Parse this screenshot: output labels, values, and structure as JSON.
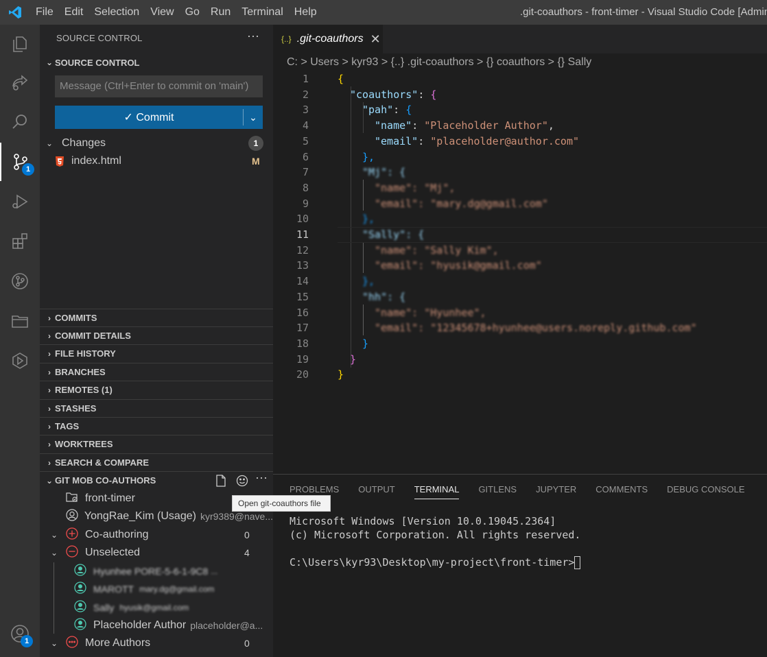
{
  "titlebar": {
    "menu": [
      "File",
      "Edit",
      "Selection",
      "View",
      "Go",
      "Run",
      "Terminal",
      "Help"
    ],
    "window_title": ".git-coauthors - front-timer - Visual Studio Code [Adminis"
  },
  "activity": {
    "scm_badge": "1",
    "accounts_badge": "1"
  },
  "sidebar": {
    "title": "SOURCE CONTROL",
    "more": "···",
    "scm_section": "SOURCE CONTROL",
    "message_placeholder": "Message (Ctrl+Enter to commit on 'main')",
    "commit_label": "✓ Commit",
    "changes_label": "Changes",
    "changes_count": "1",
    "file_name": "index.html",
    "file_status": "M",
    "sections": [
      "COMMITS",
      "COMMIT DETAILS",
      "FILE HISTORY",
      "BRANCHES",
      "REMOTES (1)",
      "STASHES",
      "TAGS",
      "WORKTREES",
      "SEARCH & COMPARE"
    ],
    "gitmob": {
      "title": "GIT MOB CO-AUTHORS",
      "repo": "front-timer",
      "user_name": "YongRae_Kim (Usage)",
      "user_email": "kyr9389@nave...",
      "coauthoring_label": "Co-authoring",
      "coauthoring_count": "0",
      "unselected_label": "Unselected",
      "unselected_count": "4",
      "authors": [
        {
          "name": "Hyunhee PORE-5-6-1-9C8",
          "email": "..."
        },
        {
          "name": "MAROTT",
          "email": "mary.dg@gmail.com"
        },
        {
          "name": "Sally",
          "email": "hyusik@gmail.com"
        },
        {
          "name": "Placeholder Author",
          "email": "placeholder@a..."
        }
      ],
      "more_authors_label": "More Authors",
      "more_authors_count": "0"
    }
  },
  "tooltip": "Open git-coauthors file",
  "editor": {
    "tab_label": ".git-coauthors",
    "breadcrumb": "C: > Users > kyr93 > {..} .git-coauthors > {} coauthors > {} Sally",
    "current_line": 11,
    "lines": [
      "1",
      "2",
      "3",
      "4",
      "5",
      "6",
      "7",
      "8",
      "9",
      "10",
      "11",
      "12",
      "13",
      "14",
      "15",
      "16",
      "17",
      "18",
      "19",
      "20"
    ],
    "code": {
      "l1": "{",
      "l2_key": "\"coauthors\"",
      "l3_key": "\"pah\"",
      "l4_key": "\"name\"",
      "l4_val": "\"Placeholder Author\"",
      "l5_key": "\"email\"",
      "l5_val": "\"placeholder@author.com\"",
      "l6": "},",
      "l7": "\"Mj\": {",
      "l8": "\"name\": \"Mj\",",
      "l9": "\"email\": \"mary.dg@gmail.com\"",
      "l10": "},",
      "l11": "\"Sally\": {",
      "l12": "\"name\": \"Sally Kim\",",
      "l13": "\"email\": \"hyusik@gmail.com\"",
      "l14": "},",
      "l15": "\"hh\": {",
      "l16": "\"name\": \"Hyunhee\",",
      "l17": "\"email\": \"12345678+hyunhee@users.noreply.github.com\"",
      "l18": "}",
      "l19": "}",
      "l20": "}"
    }
  },
  "panel": {
    "tabs": [
      "PROBLEMS",
      "OUTPUT",
      "TERMINAL",
      "GITLENS",
      "JUPYTER",
      "COMMENTS",
      "DEBUG CONSOLE"
    ],
    "active_tab": "TERMINAL",
    "terminal_lines": [
      "Microsoft Windows [Version 10.0.19045.2364]",
      "(c) Microsoft Corporation. All rights reserved.",
      "",
      "C:\\Users\\kyr93\\Desktop\\my-project\\front-timer>"
    ]
  }
}
